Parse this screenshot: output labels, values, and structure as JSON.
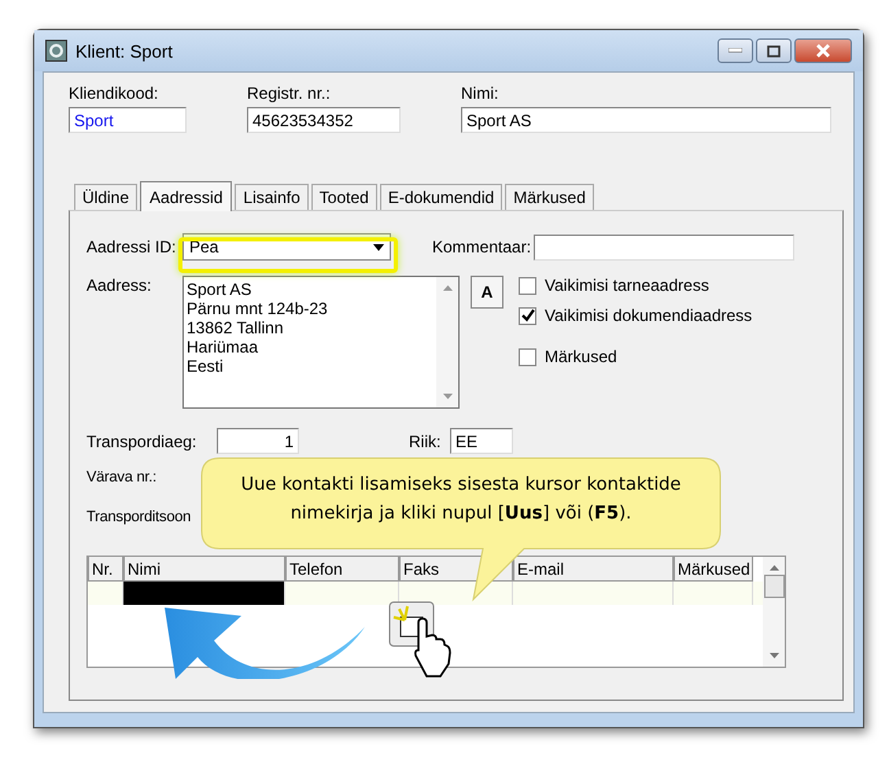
{
  "window": {
    "title": "Klient: Sport"
  },
  "header_fields": [
    {
      "label": "Kliendikood:",
      "value": "Sport",
      "focused": true
    },
    {
      "label": "Registr. nr.:",
      "value": "45623534352",
      "focused": false
    },
    {
      "label": "Nimi:",
      "value": "Sport AS",
      "focused": false
    }
  ],
  "tabs": [
    {
      "label": "Üldine",
      "selected": false
    },
    {
      "label": "Aadressid",
      "selected": true
    },
    {
      "label": "Lisainfo",
      "selected": false
    },
    {
      "label": "Tooted",
      "selected": false
    },
    {
      "label": "E-dokumendid",
      "selected": false
    },
    {
      "label": "Märkused",
      "selected": false
    }
  ],
  "address_id": {
    "label": "Aadressi ID:",
    "value": "Pea"
  },
  "comment": {
    "label": "Kommentaar:"
  },
  "address": {
    "label": "Aadress:",
    "lines": [
      "Sport AS",
      "Pärnu mnt 124b-23",
      "13862 Tallinn",
      "Hariümaa",
      "Eesti"
    ]
  },
  "format_button": "A",
  "checkboxes": [
    {
      "label": "Vaikimisi tarneaadress",
      "checked": false
    },
    {
      "label": "Vaikimisi dokumendiaadress",
      "checked": true
    },
    {
      "label": "Märkused",
      "checked": false
    }
  ],
  "transport_time": {
    "label": "Transpordiaeg:",
    "value": "1"
  },
  "country": {
    "label": "Riik:",
    "value": "EE"
  },
  "gate": {
    "label": "Värava nr.:"
  },
  "transport_zone": {
    "label": "Transporditsoon"
  },
  "callout": "Uue kontakti lisamiseks sisesta kursor kontaktide nimekirja ja kliki nupul [**Uus**] või (**F5**).",
  "contacts": {
    "columns": [
      "Nr.",
      "Nimi",
      "Telefon",
      "Faks",
      "E-mail",
      "Märkused"
    ],
    "rows": [
      {
        "selected": true
      }
    ]
  }
}
